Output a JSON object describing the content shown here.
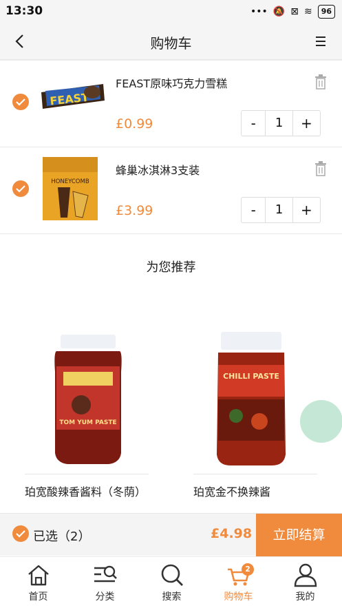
{
  "status_bar": {
    "time": "13:30",
    "battery": "96"
  },
  "header": {
    "title": "购物车"
  },
  "cart": {
    "items": [
      {
        "name": "FEAST原味巧克力雪糕",
        "price": "£0.99",
        "quantity": "1",
        "image_text": "FEAST"
      },
      {
        "name": "蜂巢冰淇淋3支装",
        "price": "£3.99",
        "quantity": "1",
        "image_text": "HONEYCOMB"
      }
    ],
    "minus": "-",
    "plus": "+"
  },
  "recommend": {
    "title": "为您推荐",
    "products": [
      {
        "name": "珀宽酸辣香酱料（冬荫）",
        "image_text": "TOM YUM PASTE"
      },
      {
        "name": "珀宽金不换辣酱",
        "image_text": "CHILLI PASTE"
      }
    ]
  },
  "checkout": {
    "selected_label": "已选（2）",
    "total": "£4.98",
    "button": "立即结算"
  },
  "tabs": [
    {
      "label": "首页",
      "icon": "home-icon"
    },
    {
      "label": "分类",
      "icon": "category-icon"
    },
    {
      "label": "搜索",
      "icon": "search-icon"
    },
    {
      "label": "购物车",
      "icon": "cart-icon",
      "badge": "2"
    },
    {
      "label": "我的",
      "icon": "user-icon"
    }
  ],
  "colors": {
    "accent": "#f08a3c",
    "background": "#f5f5f5"
  }
}
